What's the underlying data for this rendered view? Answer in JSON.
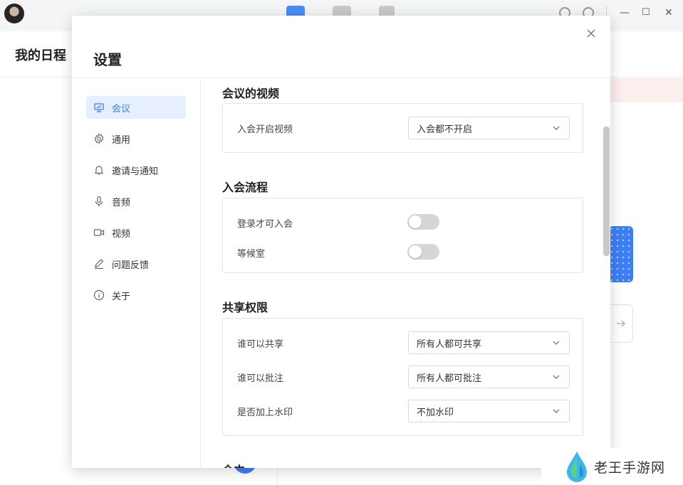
{
  "background": {
    "page_title": "我的日程",
    "watermark_text": "老王手游网",
    "window_controls": {
      "minimize": "—",
      "maximize": "☐",
      "close": "✕"
    }
  },
  "modal": {
    "title": "设置",
    "close_glyph": "✕",
    "sidebar": {
      "items": [
        {
          "label": "会议",
          "icon": "presentation-icon",
          "active": true
        },
        {
          "label": "通用",
          "icon": "gear-icon",
          "active": false
        },
        {
          "label": "邀请与通知",
          "icon": "bell-icon",
          "active": false
        },
        {
          "label": "音频",
          "icon": "microphone-icon",
          "active": false
        },
        {
          "label": "视频",
          "icon": "video-camera-icon",
          "active": false
        },
        {
          "label": "问题反馈",
          "icon": "pencil-icon",
          "active": false
        },
        {
          "label": "关于",
          "icon": "info-icon",
          "active": false
        }
      ]
    },
    "sections": {
      "video": {
        "title": "会议的视频",
        "join_video_label": "入会开启视频",
        "join_video_value": "入会都不开启"
      },
      "join_flow": {
        "title": "入会流程",
        "login_required_label": "登录才可入会",
        "login_required_on": false,
        "waiting_room_label": "等候室",
        "waiting_room_on": false
      },
      "share": {
        "title": "共享权限",
        "who_share_label": "谁可以共享",
        "who_share_value": "所有人都可共享",
        "who_annotate_label": "谁可以批注",
        "who_annotate_value": "所有人都可批注",
        "watermark_label": "是否加上水印",
        "watermark_value": "不加水印"
      },
      "partial": {
        "title": "会中"
      }
    }
  },
  "colors": {
    "accent": "#3d7ef5",
    "active_bg": "#e6efff",
    "toggle_off": "#d6d6d6"
  }
}
